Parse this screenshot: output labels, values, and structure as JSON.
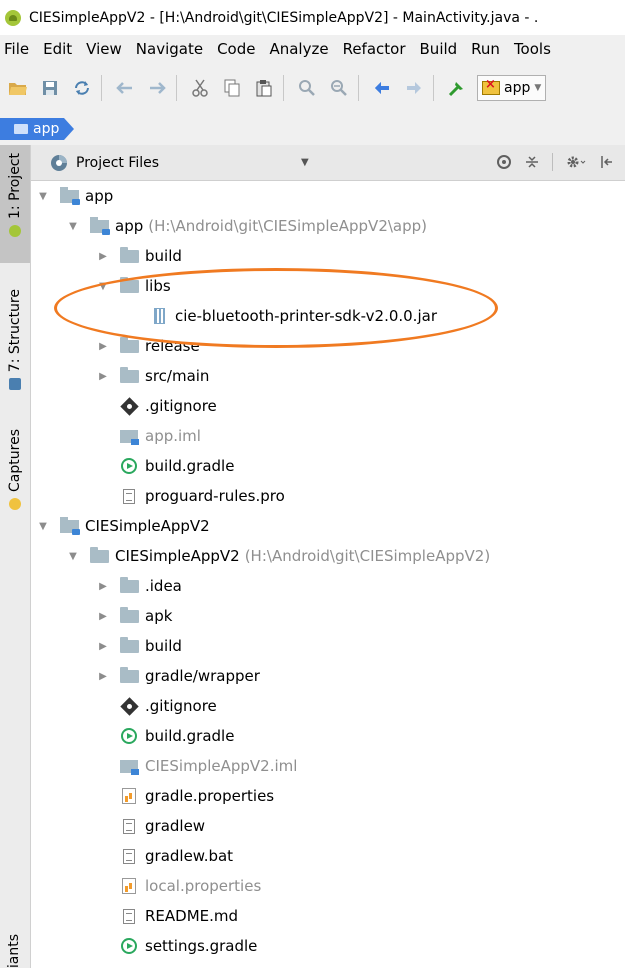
{
  "window": {
    "title": "CIESimpleAppV2 - [H:\\Android\\git\\CIESimpleAppV2] - MainActivity.java - ."
  },
  "menu": [
    "File",
    "Edit",
    "View",
    "Navigate",
    "Code",
    "Analyze",
    "Refactor",
    "Build",
    "Run",
    "Tools"
  ],
  "toolbar": {
    "run_config": "app",
    "icons": [
      "open-icon",
      "save-icon",
      "sync-icon",
      "undo-icon",
      "redo-icon",
      "cut-icon",
      "copy-icon",
      "paste-icon",
      "find-icon",
      "replace-icon",
      "back-icon",
      "forward-icon",
      "make-icon"
    ]
  },
  "navbar": {
    "crumb": "app"
  },
  "left_tabs": [
    "1: Project",
    "7: Structure",
    "Captures"
  ],
  "bottom_tab": "iants",
  "panel": {
    "view_label": "Project Files"
  },
  "tree": [
    {
      "label": "app",
      "path": "",
      "icon": "module-folder",
      "arrow": "open",
      "level": 0,
      "dim": false
    },
    {
      "label": "app",
      "path": "(H:\\Android\\git\\CIESimpleAppV2\\app)",
      "icon": "module-folder",
      "arrow": "open",
      "level": 1,
      "dim": false
    },
    {
      "label": "build",
      "path": "",
      "icon": "folder",
      "arrow": "closed",
      "level": 2,
      "dim": false
    },
    {
      "label": "libs",
      "path": "",
      "icon": "folder",
      "arrow": "open",
      "level": 2,
      "dim": false
    },
    {
      "label": "cie-bluetooth-printer-sdk-v2.0.0.jar",
      "path": "",
      "icon": "jar",
      "arrow": "none",
      "level": 3,
      "dim": false
    },
    {
      "label": "release",
      "path": "",
      "icon": "folder",
      "arrow": "closed",
      "level": 2,
      "dim": false
    },
    {
      "label": "src/main",
      "path": "",
      "icon": "folder",
      "arrow": "closed",
      "level": 2,
      "dim": false
    },
    {
      "label": ".gitignore",
      "path": "",
      "icon": "git",
      "arrow": "none",
      "level": 2,
      "dim": false
    },
    {
      "label": "app.iml",
      "path": "",
      "icon": "iml",
      "arrow": "none",
      "level": 2,
      "dim": true
    },
    {
      "label": "build.gradle",
      "path": "",
      "icon": "gradle",
      "arrow": "none",
      "level": 2,
      "dim": false
    },
    {
      "label": "proguard-rules.pro",
      "path": "",
      "icon": "file",
      "arrow": "none",
      "level": 2,
      "dim": false
    },
    {
      "label": "CIESimpleAppV2",
      "path": "",
      "icon": "module-folder",
      "arrow": "open",
      "level": 0,
      "dim": false
    },
    {
      "label": "CIESimpleAppV2",
      "path": "(H:\\Android\\git\\CIESimpleAppV2)",
      "icon": "folder",
      "arrow": "open",
      "level": 1,
      "dim": false
    },
    {
      "label": ".idea",
      "path": "",
      "icon": "folder",
      "arrow": "closed",
      "level": 2,
      "dim": false
    },
    {
      "label": "apk",
      "path": "",
      "icon": "folder",
      "arrow": "closed",
      "level": 2,
      "dim": false
    },
    {
      "label": "build",
      "path": "",
      "icon": "folder",
      "arrow": "closed",
      "level": 2,
      "dim": false
    },
    {
      "label": "gradle/wrapper",
      "path": "",
      "icon": "folder",
      "arrow": "closed",
      "level": 2,
      "dim": false
    },
    {
      "label": ".gitignore",
      "path": "",
      "icon": "git",
      "arrow": "none",
      "level": 2,
      "dim": false
    },
    {
      "label": "build.gradle",
      "path": "",
      "icon": "gradle",
      "arrow": "none",
      "level": 2,
      "dim": false
    },
    {
      "label": "CIESimpleAppV2.iml",
      "path": "",
      "icon": "iml",
      "arrow": "none",
      "level": 2,
      "dim": true
    },
    {
      "label": "gradle.properties",
      "path": "",
      "icon": "properties",
      "arrow": "none",
      "level": 2,
      "dim": false
    },
    {
      "label": "gradlew",
      "path": "",
      "icon": "file",
      "arrow": "none",
      "level": 2,
      "dim": false
    },
    {
      "label": "gradlew.bat",
      "path": "",
      "icon": "file",
      "arrow": "none",
      "level": 2,
      "dim": false
    },
    {
      "label": "local.properties",
      "path": "",
      "icon": "properties",
      "arrow": "none",
      "level": 2,
      "dim": true
    },
    {
      "label": "README.md",
      "path": "",
      "icon": "file",
      "arrow": "none",
      "level": 2,
      "dim": false
    },
    {
      "label": "settings.gradle",
      "path": "",
      "icon": "gradle",
      "arrow": "none",
      "level": 2,
      "dim": false
    }
  ],
  "colors": {
    "highlight_oval": "#f07a21",
    "crumb": "#3d7de0",
    "folder": "#a9bcc6",
    "gradle": "#2aa85e"
  }
}
